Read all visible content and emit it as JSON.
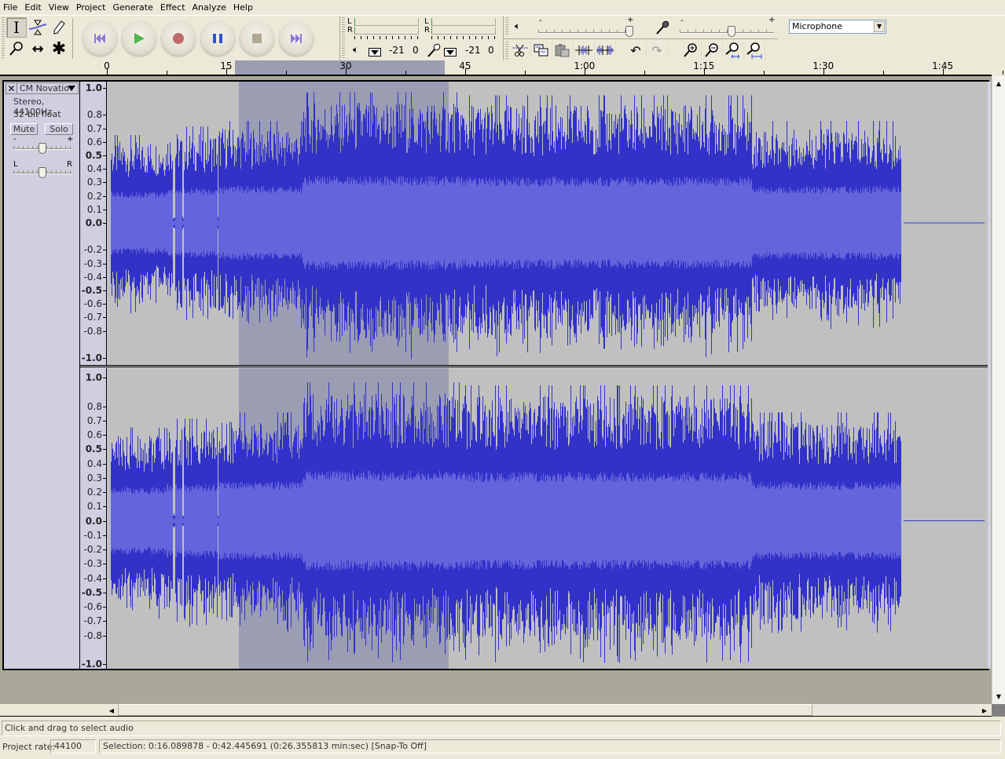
{
  "menubar": {
    "items": [
      "File",
      "Edit",
      "View",
      "Project",
      "Generate",
      "Effect",
      "Analyze",
      "Help"
    ]
  },
  "tools": {
    "items": [
      {
        "name": "selection-tool",
        "glyph": "I",
        "active": true
      },
      {
        "name": "envelope-tool",
        "glyph": "⧗",
        "active": false
      },
      {
        "name": "draw-tool",
        "glyph": "✎",
        "active": false
      },
      {
        "name": "zoom-tool",
        "glyph": "⚲",
        "active": false
      },
      {
        "name": "timeshift-tool",
        "glyph": "↔",
        "active": false
      },
      {
        "name": "multi-tool",
        "glyph": "✱",
        "active": false
      }
    ]
  },
  "transport": {
    "colors": {
      "skip": "#8a78d8",
      "play": "#4cb84c",
      "record": "#c06a6a",
      "pause": "#3050d0",
      "stop": "#b0a890"
    }
  },
  "meters": {
    "playback": {
      "left_label": "L",
      "right_label": "R",
      "scale": [
        "-21",
        "0"
      ]
    },
    "record": {
      "left_label": "L",
      "right_label": "R",
      "scale": [
        "-21",
        "0"
      ]
    }
  },
  "mixer": {
    "output_volume": {
      "min_label": "-",
      "max_label": "+",
      "level": 0.97
    },
    "input_volume": {
      "min_label": "-",
      "max_label": "+",
      "level": 0.55
    },
    "input_device": "Microphone"
  },
  "ruler": {
    "labels": [
      {
        "text": "0",
        "seconds": 0
      },
      {
        "text": "15",
        "seconds": 15
      },
      {
        "text": "30",
        "seconds": 30
      },
      {
        "text": "45",
        "seconds": 45
      },
      {
        "text": "1:00",
        "seconds": 60
      },
      {
        "text": "1:15",
        "seconds": 75
      },
      {
        "text": "1:30",
        "seconds": 90
      },
      {
        "text": "1:45",
        "seconds": 105
      }
    ],
    "selection_start": 16.089878,
    "selection_end": 42.445691,
    "audio_end": 99.6
  },
  "track": {
    "name": "CM Novatio",
    "close_glyph": "✕",
    "info_line1": "Stereo, 44100Hz",
    "info_line2": "32-bit float",
    "mute_label": "Mute",
    "solo_label": "Solo",
    "gain": {
      "min_label": "-",
      "max_label": "+",
      "value": 0.5
    },
    "pan": {
      "min_label": "L",
      "max_label": "R",
      "value": 0.5
    },
    "amplitude_labels": [
      "1.0",
      "0.8",
      "0.7",
      "0.6",
      "0.5",
      "0.4",
      "0.3",
      "0.2",
      "0.1",
      "0.0",
      "-0.1",
      "-0.2",
      "-0.3",
      "-0.4",
      "-0.5",
      "-0.6",
      "-0.7",
      "-0.8",
      "-1.0"
    ],
    "channel1_hidden_labels": [
      "-0.1"
    ],
    "waveform_colors": {
      "peak": "#3232c8",
      "rms": "#6464dc",
      "background": "#c0c0c0",
      "selected_background": "#9b9db3"
    }
  },
  "status": {
    "message": "Click and drag to select audio",
    "project_rate_label": "Project rate:",
    "project_rate": "44100",
    "selection_text": "Selection: 0:16.089878 - 0:42.445691 (0:26.355813 min:sec)   [Snap-To Off]"
  }
}
